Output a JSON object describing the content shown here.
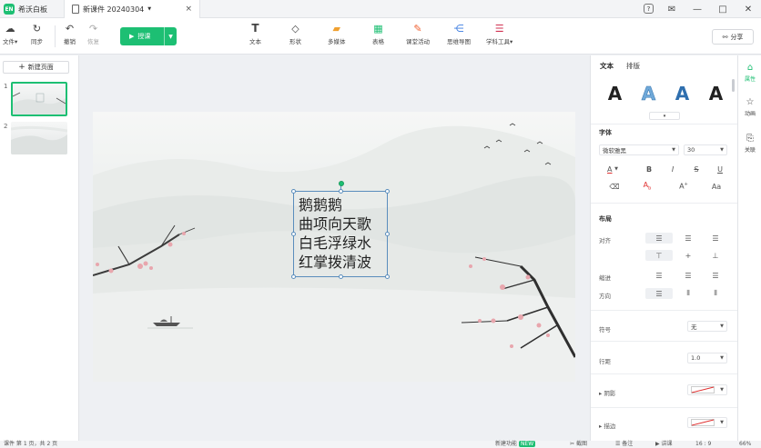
{
  "app": {
    "name": "希沃白板",
    "logo": "EN"
  },
  "doc_tab": {
    "title": "新课件 20240304",
    "close": "×"
  },
  "window_controls": {
    "help": "?",
    "feedback": "✉",
    "minimize": "—",
    "maximize": "□",
    "close": "✕"
  },
  "toolbar": {
    "file": "文件",
    "sync": "同步",
    "undo": "撤销",
    "redo": "恢复",
    "play": "授课",
    "text": "文本",
    "shape": "形状",
    "media": "多媒体",
    "table": "表格",
    "activity": "课堂活动",
    "mindmap": "思维导图",
    "subject_tools": "学科工具",
    "share": "分享"
  },
  "left_panel": {
    "new_page": "新建页面",
    "pages": [
      "1",
      "2"
    ]
  },
  "slide": {
    "poem": [
      "鹅鹅鹅",
      "曲项向天歌",
      "白毛浮绿水",
      "红掌拨清波"
    ]
  },
  "right_panel": {
    "tabs": [
      "文本",
      "排版"
    ],
    "style_samples": [
      "A",
      "A",
      "A",
      "A"
    ],
    "font_section": "字体",
    "font_name": "微软雅黑",
    "font_size": "30",
    "layout_section": "布局",
    "align_label": "对齐",
    "indent_label": "缩进",
    "direction_label": "方向",
    "bullet_label": "符号",
    "bullet_value": "无",
    "line_spacing_label": "行距",
    "line_spacing_value": "1.0",
    "shadow_label": "阴影",
    "stroke_label": "描边"
  },
  "side_rail": [
    "属性",
    "动画",
    "关联"
  ],
  "statusbar": {
    "page_info": "课件 第 1 页，共 2 页",
    "new_feature": "新建功能",
    "new_badge": "NEW",
    "screenshot": "截图",
    "notes": "备注",
    "present": "讲课",
    "ratio": "16 : 9",
    "zoom": "66%"
  },
  "colors": {
    "accent": "#1dbf73",
    "selection": "#5a8dbd"
  }
}
